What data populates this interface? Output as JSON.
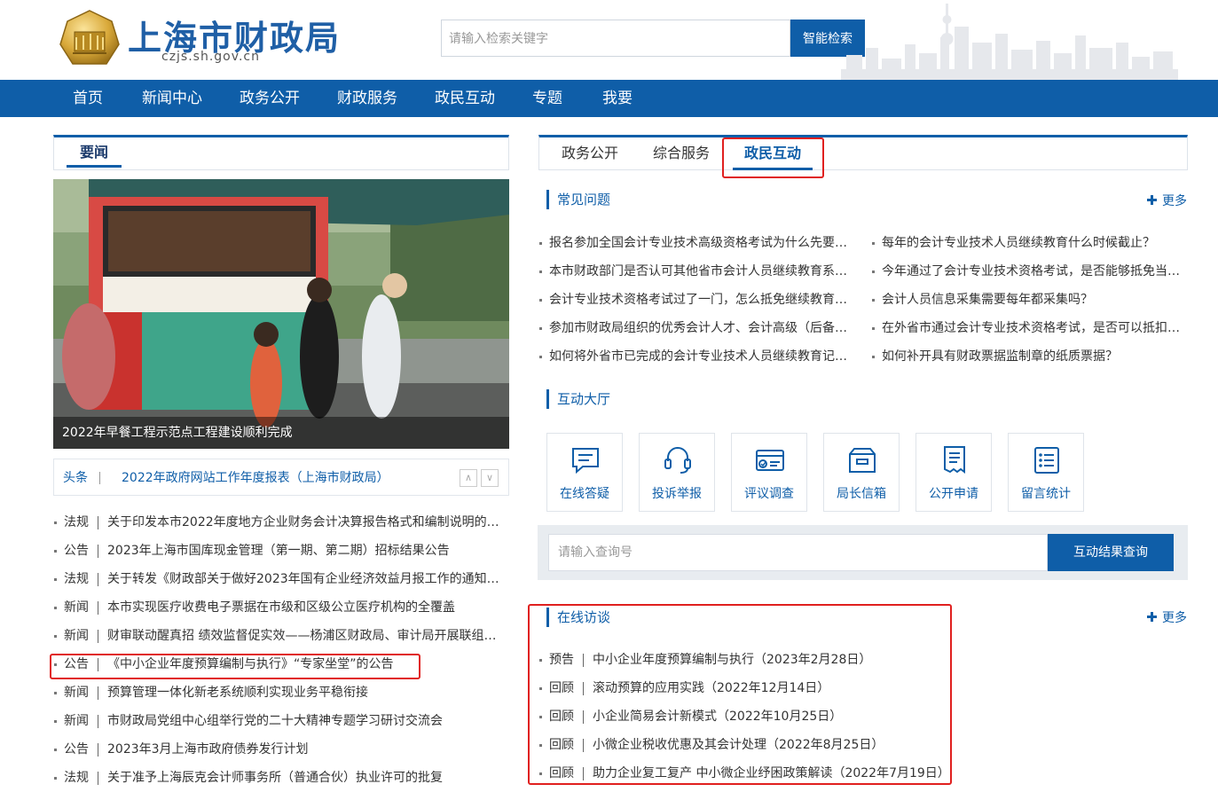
{
  "header": {
    "site_title": "上海市财政局",
    "site_domain": "czjs.sh.gov.cn",
    "search_placeholder": "请输入检索关键字",
    "search_button": "智能检索"
  },
  "nav": [
    "首页",
    "新闻中心",
    "政务公开",
    "财政服务",
    "政民互动",
    "专题",
    "我要"
  ],
  "left": {
    "tab_label": "要闻",
    "photo_caption": "2022年早餐工程示范点工程建设顺利完成",
    "headline": {
      "label": "头条",
      "text": "2022年政府网站工作年度报表（上海市财政局）",
      "up_arrow": "∧",
      "down_arrow": "∨"
    },
    "news": [
      {
        "cat": "法规",
        "title": "关于印发本市2022年度地方企业财务会计决算报告格式和编制说明的通知"
      },
      {
        "cat": "公告",
        "title": "2023年上海市国库现金管理（第一期、第二期）招标结果公告"
      },
      {
        "cat": "法规",
        "title": "关于转发《财政部关于做好2023年国有企业经济效益月报工作的通知》的通知"
      },
      {
        "cat": "新闻",
        "title": "本市实现医疗收费电子票据在市级和区级公立医疗机构的全覆盖"
      },
      {
        "cat": "新闻",
        "title": "财审联动醒真招 绩效监督促实效——杨浦区财政局、审计局开展联组学习"
      },
      {
        "cat": "公告",
        "title": "《中小企业年度预算编制与执行》“专家坐堂”的公告"
      },
      {
        "cat": "新闻",
        "title": "预算管理一体化新老系统顺利实现业务平稳衔接"
      },
      {
        "cat": "新闻",
        "title": "市财政局党组中心组举行党的二十大精神专题学习研讨交流会"
      },
      {
        "cat": "公告",
        "title": "2023年3月上海市政府债券发行计划"
      },
      {
        "cat": "法规",
        "title": "关于准予上海辰克会计师事务所（普通合伙）执业许可的批复"
      }
    ]
  },
  "right": {
    "tabs": [
      "政务公开",
      "综合服务",
      "政民互动"
    ],
    "faq_title": "常见问题",
    "more_label": "更多",
    "faq_left": [
      "报名参加全国会计专业技术高级资格考试为什么先要进行资格审核？",
      "本市财政部门是否认可其他省市会计人员继续教育系统学时？",
      "会计专业技术资格考试过了一门，怎么抵免继续教育学时？",
      "参加市财政局组织的优秀会计人才、会计高级（后备）人才培养",
      "如何将外省市已完成的会计专业技术人员继续教育记录转入本市？"
    ],
    "faq_right": [
      "每年的会计专业技术人员继续教育什么时候截止？",
      "今年通过了会计专业技术资格考试，是否能够抵免当年继续教育？",
      "会计人员信息采集需要每年都采集吗？",
      "在外省市通过会计专业技术资格考试，是否可以抵扣会计继续教育？",
      "如何补开具有财政票据监制章的纸质票据？"
    ],
    "hall_title": "互动大厅",
    "tiles": [
      {
        "label": "在线答疑",
        "icon": "chat-icon"
      },
      {
        "label": "投诉举报",
        "icon": "headset-icon"
      },
      {
        "label": "评议调查",
        "icon": "survey-icon"
      },
      {
        "label": "局长信箱",
        "icon": "mailbox-icon"
      },
      {
        "label": "公开申请",
        "icon": "document-icon"
      },
      {
        "label": "留言统计",
        "icon": "list-icon"
      }
    ],
    "query_placeholder": "请输入查询号",
    "query_button": "互动结果查询",
    "interview_title": "在线访谈",
    "interviews": [
      {
        "cat": "预告",
        "title": "中小企业年度预算编制与执行（2023年2月28日）"
      },
      {
        "cat": "回顾",
        "title": "滚动预算的应用实践（2022年12月14日）"
      },
      {
        "cat": "回顾",
        "title": "小企业简易会计新模式（2022年10月25日）"
      },
      {
        "cat": "回顾",
        "title": "小微企业税收优惠及其会计处理（2022年8月25日）"
      },
      {
        "cat": "回顾",
        "title": "助力企业复工复产 中小微企业纾困政策解读（2022年7月19日）"
      }
    ]
  },
  "colors": {
    "brand_blue": "#0f5ea8",
    "highlight_red": "#e0201f"
  }
}
